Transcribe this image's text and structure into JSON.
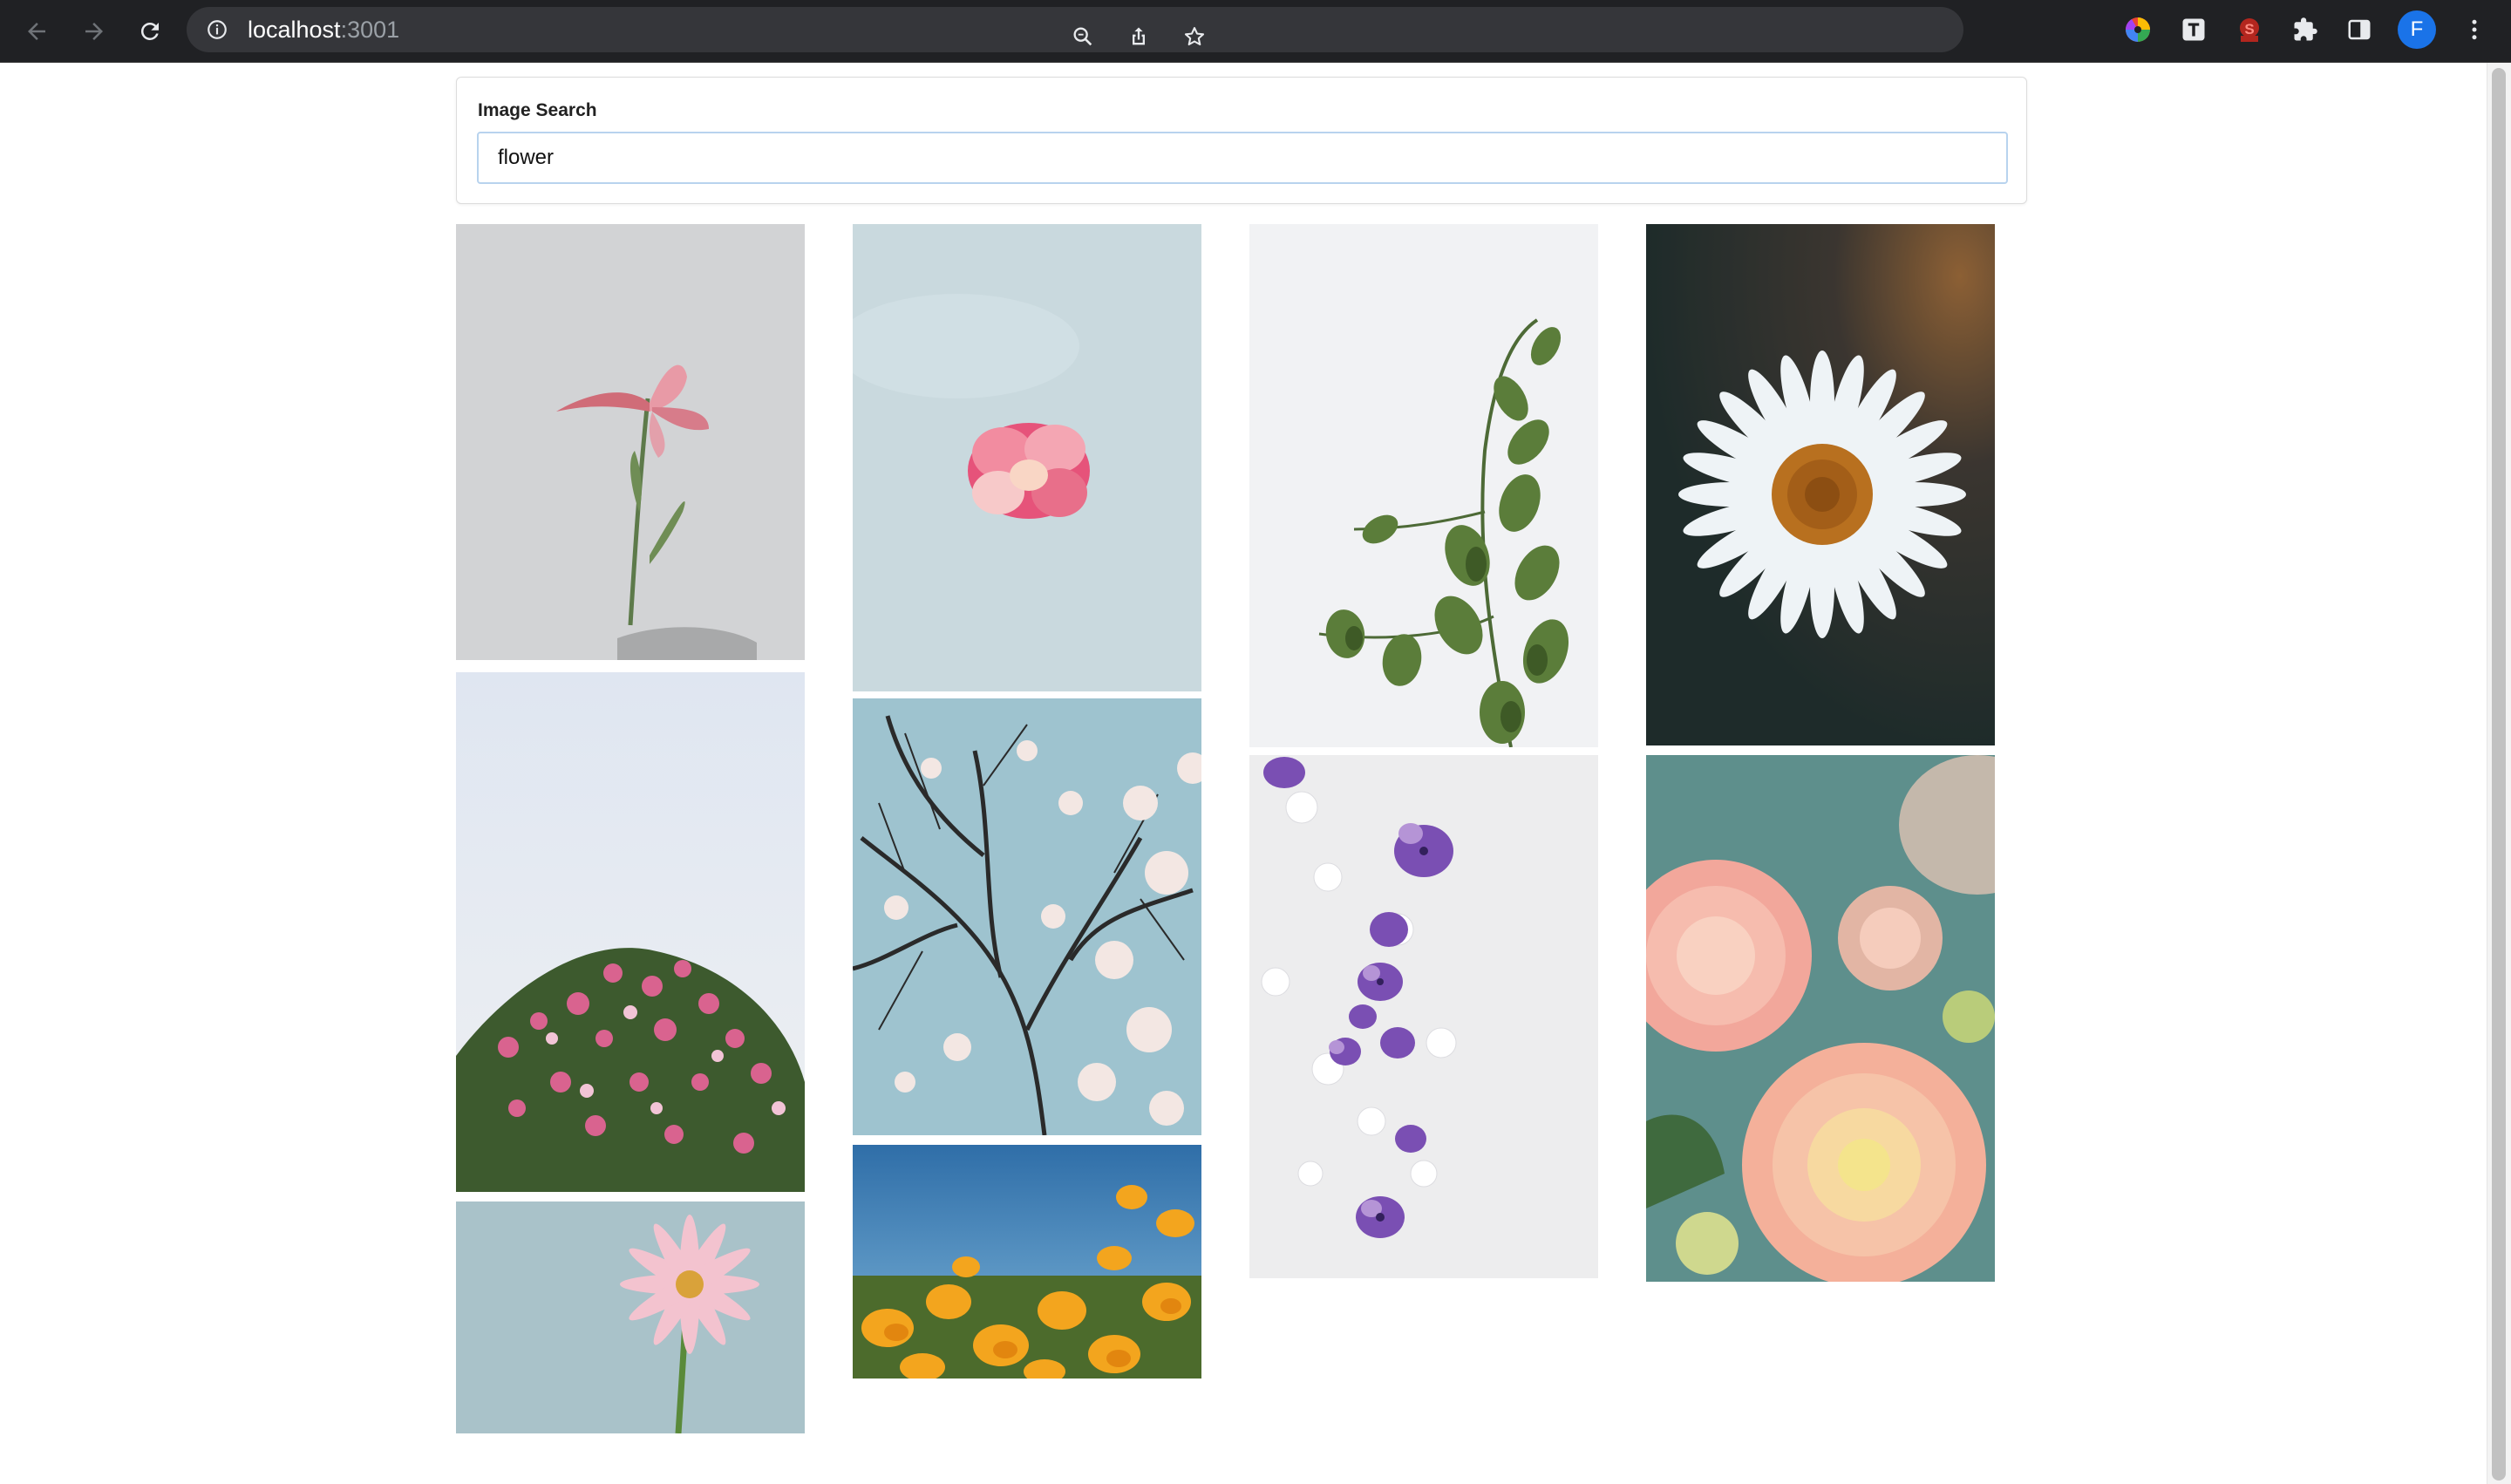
{
  "browser": {
    "url_host": "localhost",
    "url_port": ":3001",
    "profile_initial": "F"
  },
  "search": {
    "label": "Image Search",
    "value": "flower"
  },
  "gallery": {
    "images": [
      {
        "subject": "pink lily on gray"
      },
      {
        "subject": "pink blossom in clouds"
      },
      {
        "subject": "green eucalyptus branch"
      },
      {
        "subject": "white daisy"
      },
      {
        "subject": "pink blossoms on sky"
      },
      {
        "subject": "cherry tree branches"
      },
      {
        "subject": "purple petals on white"
      },
      {
        "subject": "peach dahlias"
      },
      {
        "subject": "pink gerbera daisy"
      },
      {
        "subject": "orange poppies field"
      }
    ]
  },
  "colors": {
    "chrome_bg": "#202124",
    "omnibox_bg": "#35363a",
    "avatar_bg": "#1a73e8",
    "input_border": "#b8d3ee"
  }
}
